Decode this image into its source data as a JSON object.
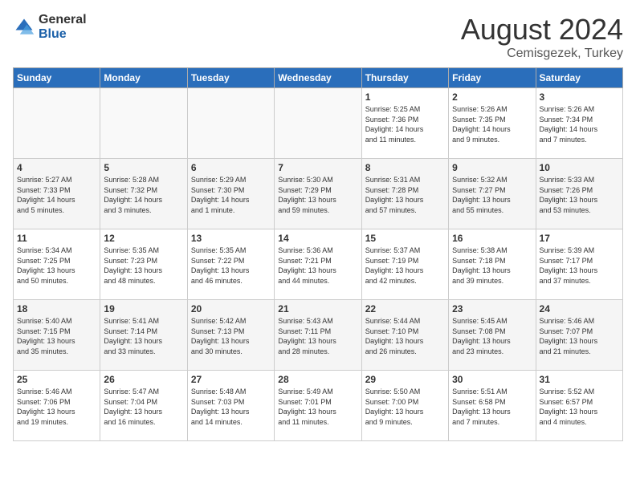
{
  "logo": {
    "general": "General",
    "blue": "Blue"
  },
  "header": {
    "month": "August 2024",
    "location": "Cemisgezek, Turkey"
  },
  "weekdays": [
    "Sunday",
    "Monday",
    "Tuesday",
    "Wednesday",
    "Thursday",
    "Friday",
    "Saturday"
  ],
  "weeks": [
    [
      {
        "day": "",
        "info": ""
      },
      {
        "day": "",
        "info": ""
      },
      {
        "day": "",
        "info": ""
      },
      {
        "day": "",
        "info": ""
      },
      {
        "day": "1",
        "info": "Sunrise: 5:25 AM\nSunset: 7:36 PM\nDaylight: 14 hours\nand 11 minutes."
      },
      {
        "day": "2",
        "info": "Sunrise: 5:26 AM\nSunset: 7:35 PM\nDaylight: 14 hours\nand 9 minutes."
      },
      {
        "day": "3",
        "info": "Sunrise: 5:26 AM\nSunset: 7:34 PM\nDaylight: 14 hours\nand 7 minutes."
      }
    ],
    [
      {
        "day": "4",
        "info": "Sunrise: 5:27 AM\nSunset: 7:33 PM\nDaylight: 14 hours\nand 5 minutes."
      },
      {
        "day": "5",
        "info": "Sunrise: 5:28 AM\nSunset: 7:32 PM\nDaylight: 14 hours\nand 3 minutes."
      },
      {
        "day": "6",
        "info": "Sunrise: 5:29 AM\nSunset: 7:30 PM\nDaylight: 14 hours\nand 1 minute."
      },
      {
        "day": "7",
        "info": "Sunrise: 5:30 AM\nSunset: 7:29 PM\nDaylight: 13 hours\nand 59 minutes."
      },
      {
        "day": "8",
        "info": "Sunrise: 5:31 AM\nSunset: 7:28 PM\nDaylight: 13 hours\nand 57 minutes."
      },
      {
        "day": "9",
        "info": "Sunrise: 5:32 AM\nSunset: 7:27 PM\nDaylight: 13 hours\nand 55 minutes."
      },
      {
        "day": "10",
        "info": "Sunrise: 5:33 AM\nSunset: 7:26 PM\nDaylight: 13 hours\nand 53 minutes."
      }
    ],
    [
      {
        "day": "11",
        "info": "Sunrise: 5:34 AM\nSunset: 7:25 PM\nDaylight: 13 hours\nand 50 minutes."
      },
      {
        "day": "12",
        "info": "Sunrise: 5:35 AM\nSunset: 7:23 PM\nDaylight: 13 hours\nand 48 minutes."
      },
      {
        "day": "13",
        "info": "Sunrise: 5:35 AM\nSunset: 7:22 PM\nDaylight: 13 hours\nand 46 minutes."
      },
      {
        "day": "14",
        "info": "Sunrise: 5:36 AM\nSunset: 7:21 PM\nDaylight: 13 hours\nand 44 minutes."
      },
      {
        "day": "15",
        "info": "Sunrise: 5:37 AM\nSunset: 7:19 PM\nDaylight: 13 hours\nand 42 minutes."
      },
      {
        "day": "16",
        "info": "Sunrise: 5:38 AM\nSunset: 7:18 PM\nDaylight: 13 hours\nand 39 minutes."
      },
      {
        "day": "17",
        "info": "Sunrise: 5:39 AM\nSunset: 7:17 PM\nDaylight: 13 hours\nand 37 minutes."
      }
    ],
    [
      {
        "day": "18",
        "info": "Sunrise: 5:40 AM\nSunset: 7:15 PM\nDaylight: 13 hours\nand 35 minutes."
      },
      {
        "day": "19",
        "info": "Sunrise: 5:41 AM\nSunset: 7:14 PM\nDaylight: 13 hours\nand 33 minutes."
      },
      {
        "day": "20",
        "info": "Sunrise: 5:42 AM\nSunset: 7:13 PM\nDaylight: 13 hours\nand 30 minutes."
      },
      {
        "day": "21",
        "info": "Sunrise: 5:43 AM\nSunset: 7:11 PM\nDaylight: 13 hours\nand 28 minutes."
      },
      {
        "day": "22",
        "info": "Sunrise: 5:44 AM\nSunset: 7:10 PM\nDaylight: 13 hours\nand 26 minutes."
      },
      {
        "day": "23",
        "info": "Sunrise: 5:45 AM\nSunset: 7:08 PM\nDaylight: 13 hours\nand 23 minutes."
      },
      {
        "day": "24",
        "info": "Sunrise: 5:46 AM\nSunset: 7:07 PM\nDaylight: 13 hours\nand 21 minutes."
      }
    ],
    [
      {
        "day": "25",
        "info": "Sunrise: 5:46 AM\nSunset: 7:06 PM\nDaylight: 13 hours\nand 19 minutes."
      },
      {
        "day": "26",
        "info": "Sunrise: 5:47 AM\nSunset: 7:04 PM\nDaylight: 13 hours\nand 16 minutes."
      },
      {
        "day": "27",
        "info": "Sunrise: 5:48 AM\nSunset: 7:03 PM\nDaylight: 13 hours\nand 14 minutes."
      },
      {
        "day": "28",
        "info": "Sunrise: 5:49 AM\nSunset: 7:01 PM\nDaylight: 13 hours\nand 11 minutes."
      },
      {
        "day": "29",
        "info": "Sunrise: 5:50 AM\nSunset: 7:00 PM\nDaylight: 13 hours\nand 9 minutes."
      },
      {
        "day": "30",
        "info": "Sunrise: 5:51 AM\nSunset: 6:58 PM\nDaylight: 13 hours\nand 7 minutes."
      },
      {
        "day": "31",
        "info": "Sunrise: 5:52 AM\nSunset: 6:57 PM\nDaylight: 13 hours\nand 4 minutes."
      }
    ]
  ]
}
